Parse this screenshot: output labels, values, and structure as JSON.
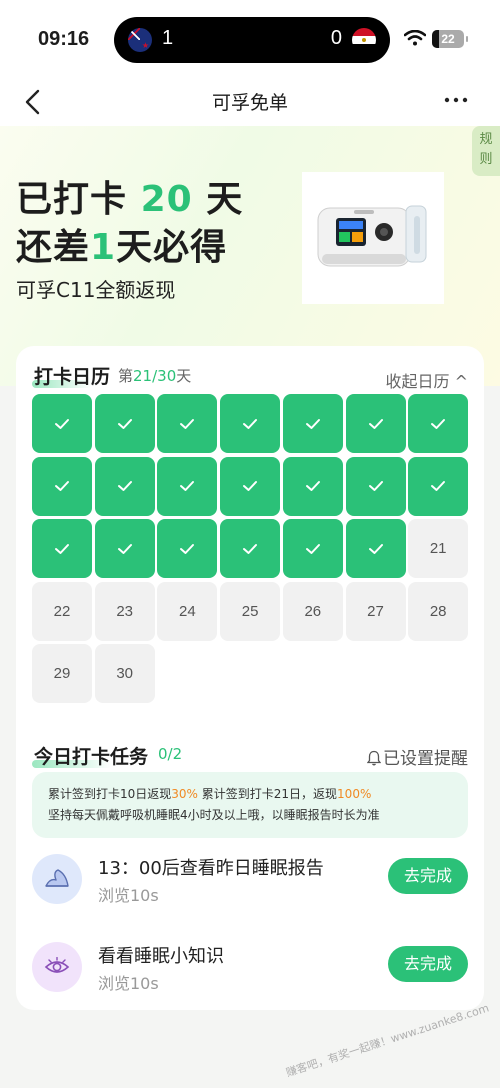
{
  "status": {
    "time": "09:16",
    "score_left": "1",
    "score_right": "0",
    "battery": "22",
    "battery_level": 0.22
  },
  "nav": {
    "title": "可孚免单"
  },
  "hero": {
    "rules_label_1": "规",
    "rules_label_2": "则",
    "line1_prefix": "已打卡",
    "line1_days": "20",
    "line1_suffix": "天",
    "line2_prefix": "还差",
    "line2_days": "1",
    "line2_suffix": "天必得",
    "subtitle": "可孚C11全额返现"
  },
  "calendar": {
    "title": "打卡日历",
    "progress_prefix": "第",
    "progress_value": "21/30",
    "progress_suffix": "天",
    "collapse_label": "收起日历 ^",
    "days": [
      {
        "label": "",
        "done": true
      },
      {
        "label": "",
        "done": true
      },
      {
        "label": "",
        "done": true
      },
      {
        "label": "",
        "done": true
      },
      {
        "label": "",
        "done": true
      },
      {
        "label": "",
        "done": true
      },
      {
        "label": "",
        "done": true
      },
      {
        "label": "",
        "done": true
      },
      {
        "label": "",
        "done": true
      },
      {
        "label": "",
        "done": true
      },
      {
        "label": "",
        "done": true
      },
      {
        "label": "",
        "done": true
      },
      {
        "label": "",
        "done": true
      },
      {
        "label": "",
        "done": true
      },
      {
        "label": "",
        "done": true
      },
      {
        "label": "",
        "done": true
      },
      {
        "label": "",
        "done": true
      },
      {
        "label": "",
        "done": true
      },
      {
        "label": "",
        "done": true
      },
      {
        "label": "",
        "done": true
      },
      {
        "label": "21",
        "done": false
      },
      {
        "label": "22",
        "done": false
      },
      {
        "label": "23",
        "done": false
      },
      {
        "label": "24",
        "done": false
      },
      {
        "label": "25",
        "done": false
      },
      {
        "label": "26",
        "done": false
      },
      {
        "label": "27",
        "done": false
      },
      {
        "label": "28",
        "done": false
      },
      {
        "label": "29",
        "done": false
      },
      {
        "label": "30",
        "done": false
      }
    ]
  },
  "tasks": {
    "title": "今日打卡任务",
    "progress": "0/2",
    "reminder_label": "已设置提醒",
    "notice": {
      "p1": "累计签到打卡10日返现",
      "p1_pct": "30%",
      "p2": " 累计签到打卡21日，返现",
      "p2_pct": "100%",
      "line2": "坚持每天佩戴呼吸机睡眠4小时及以上哦，以睡眠报告时长为准"
    },
    "items": [
      {
        "icon": "moon-icon",
        "name": "13：00后查看昨日睡眠报告",
        "meta": "浏览10s",
        "button": "去完成"
      },
      {
        "icon": "eye-icon",
        "name": "看看睡眠小知识",
        "meta": "浏览10s",
        "button": "去完成"
      }
    ]
  },
  "watermark": "赚客吧，有奖一起赚！www.zuanke8.com",
  "colors": {
    "accent": "#2bc178",
    "orange": "#f08a24"
  }
}
